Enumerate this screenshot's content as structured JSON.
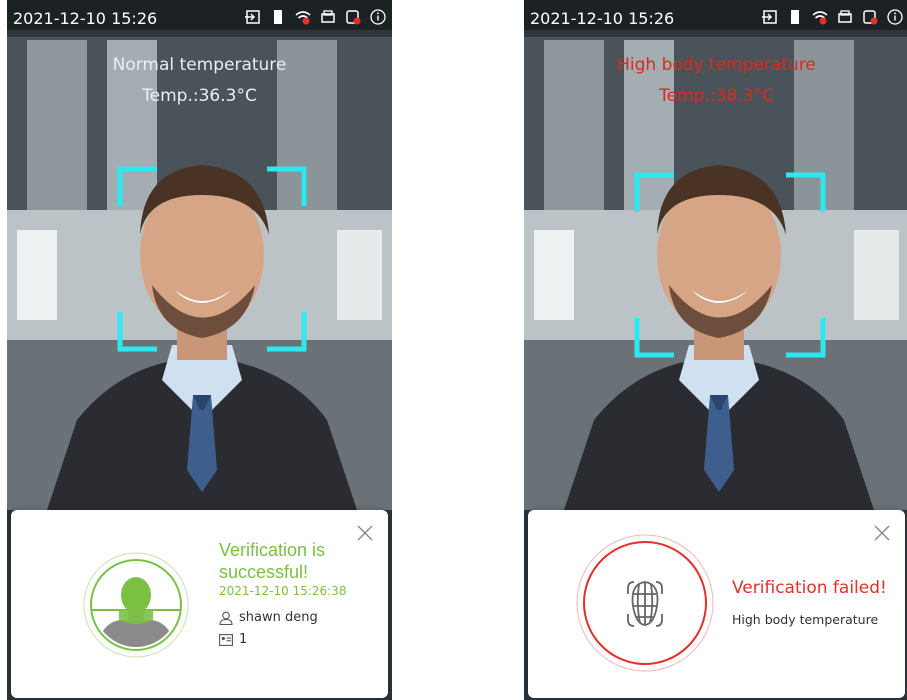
{
  "screens": [
    {
      "status": {
        "time": "2021-12-10 15:26",
        "icons": [
          "exit-icon",
          "door-sensor-icon",
          "wifi-off-icon",
          "printer-icon",
          "database-alert-icon",
          "info-icon"
        ]
      },
      "temp_title": "Normal temperature",
      "temp_value": "Temp.:36.3°C",
      "temp_color": "#e8eef4",
      "card": {
        "result": "success",
        "title": "Verification is successful!",
        "time": "2021-12-10 15:26:38",
        "user_name": "shawn deng",
        "user_id": "1",
        "accent": "#7ac143"
      }
    },
    {
      "status": {
        "time": "2021-12-10 15:26",
        "icons": [
          "exit-icon",
          "door-sensor-icon",
          "wifi-off-icon",
          "printer-icon",
          "database-alert-icon",
          "info-icon"
        ]
      },
      "temp_title": "High body temperature",
      "temp_value": "Temp.:38.3°C",
      "temp_color": "#e5261e",
      "card": {
        "result": "failed",
        "title": "Verification failed!",
        "reason": "High body temperature",
        "accent": "#e52f2a"
      }
    }
  ],
  "colors": {
    "frame": "#2ee8f0",
    "success": "#7ac143",
    "fail": "#e52f2a"
  }
}
